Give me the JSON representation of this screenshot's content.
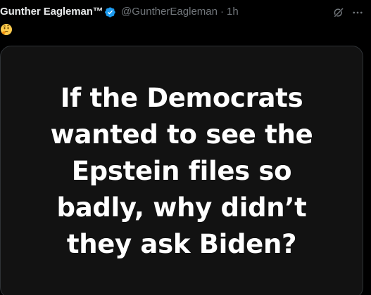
{
  "tweet": {
    "display_name": "Gunther Eagleman™",
    "handle": "@GuntherEagleman",
    "separator": "·",
    "time": "1h",
    "verified": true,
    "verified_color": "#1d9bf0",
    "emoji": "thinking-face",
    "actions": {
      "grok_icon": "grok-icon",
      "more_icon": "more-options-icon"
    }
  },
  "media": {
    "background": "#121212",
    "text_lines": [
      "If the Democrats",
      "wanted to see the",
      "Epstein files so",
      "badly, why didn’t",
      "they ask Biden?"
    ]
  }
}
